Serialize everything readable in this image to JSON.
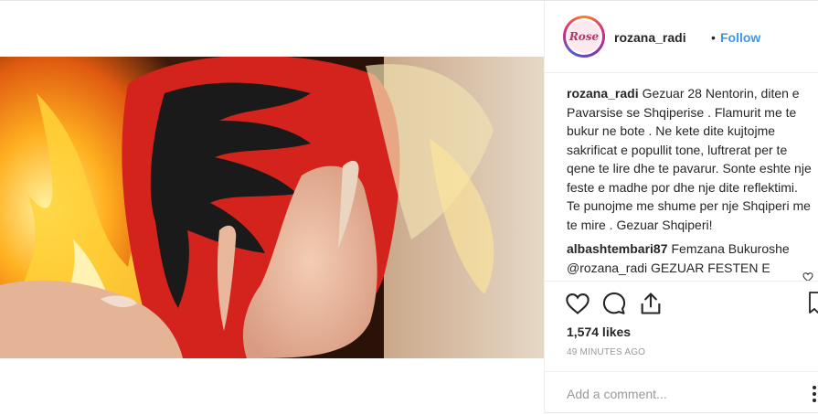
{
  "header": {
    "avatar_text": "Rose",
    "username": "rozana_radi",
    "separator": "•",
    "follow_label": "Follow"
  },
  "caption": {
    "username": "rozana_radi",
    "text": "Gezuar 28 Nentorin, diten e Pavarsise se Shqiperise . Flamurit me te bukur ne bote . Ne kete dite kujtojme sakrificat e popullit tone, luftrerat per te qene te lire dhe te pavarur. Sonte eshte nje feste e madhe por dhe nje dite reflektimi. Te punojme me shume per nje Shqiperi me te mire . Gezuar Shqiperi!"
  },
  "comments": [
    {
      "username": "albashtembari87",
      "text": "Femzana Bukuroshe @rozana_radi GEZUAR FESTEN E PAVARESISE TE GJITH SHQIPETAREVE KUDO QE NDODHEN JEMI MOTRA E"
    }
  ],
  "actions": {
    "like_icon": "heart-icon",
    "comment_icon": "comment-icon",
    "share_icon": "share-icon",
    "save_icon": "bookmark-icon"
  },
  "likes": "1,574 likes",
  "timestamp": "49 MINUTES AGO",
  "add_comment_placeholder": "Add a comment...",
  "colors": {
    "accent": "#3897f0",
    "text": "#262626",
    "muted": "#999999",
    "flag_red": "#e41e20",
    "eagle": "#1a1a1a"
  }
}
